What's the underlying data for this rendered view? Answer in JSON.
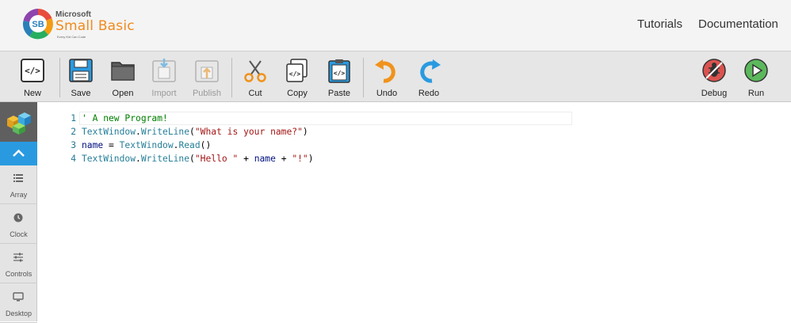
{
  "header": {
    "logo": {
      "brand": "Microsoft",
      "product": "Small Basic",
      "tagline": "Every Kid Can Code"
    },
    "nav": {
      "tutorials": "Tutorials",
      "documentation": "Documentation"
    }
  },
  "toolbar": {
    "new": "New",
    "save": "Save",
    "open": "Open",
    "import": "Import",
    "publish": "Publish",
    "cut": "Cut",
    "copy": "Copy",
    "paste": "Paste",
    "undo": "Undo",
    "redo": "Redo",
    "debug": "Debug",
    "run": "Run"
  },
  "sidebar": {
    "items": [
      {
        "label": "Array",
        "icon": "list-icon"
      },
      {
        "label": "Clock",
        "icon": "clock-icon"
      },
      {
        "label": "Controls",
        "icon": "sliders-icon"
      },
      {
        "label": "Desktop",
        "icon": "monitor-icon"
      }
    ]
  },
  "editor": {
    "lines": [
      {
        "num": "1",
        "tokens": [
          {
            "t": "' A new Program!",
            "c": "cmt"
          }
        ]
      },
      {
        "num": "2",
        "tokens": [
          {
            "t": "TextWindow",
            "c": "obj"
          },
          {
            "t": ".",
            "c": "plain"
          },
          {
            "t": "WriteLine",
            "c": "obj"
          },
          {
            "t": "(",
            "c": "plain"
          },
          {
            "t": "\"What is your name?\"",
            "c": "str"
          },
          {
            "t": ")",
            "c": "plain"
          }
        ]
      },
      {
        "num": "3",
        "tokens": [
          {
            "t": "name",
            "c": "var"
          },
          {
            "t": " = ",
            "c": "plain"
          },
          {
            "t": "TextWindow",
            "c": "obj"
          },
          {
            "t": ".",
            "c": "plain"
          },
          {
            "t": "Read",
            "c": "obj"
          },
          {
            "t": "()",
            "c": "plain"
          }
        ]
      },
      {
        "num": "4",
        "tokens": [
          {
            "t": "TextWindow",
            "c": "obj"
          },
          {
            "t": ".",
            "c": "plain"
          },
          {
            "t": "WriteLine",
            "c": "obj"
          },
          {
            "t": "(",
            "c": "plain"
          },
          {
            "t": "\"Hello \"",
            "c": "str"
          },
          {
            "t": " + ",
            "c": "plain"
          },
          {
            "t": "name",
            "c": "var"
          },
          {
            "t": " + ",
            "c": "plain"
          },
          {
            "t": "\"!\"",
            "c": "str"
          },
          {
            "t": ")",
            "c": "plain"
          }
        ]
      }
    ]
  },
  "colors": {
    "accent_blue": "#2a9ae0",
    "run_green": "#5cb85c",
    "debug_red": "#d9534f",
    "undo_orange": "#f0931c"
  }
}
